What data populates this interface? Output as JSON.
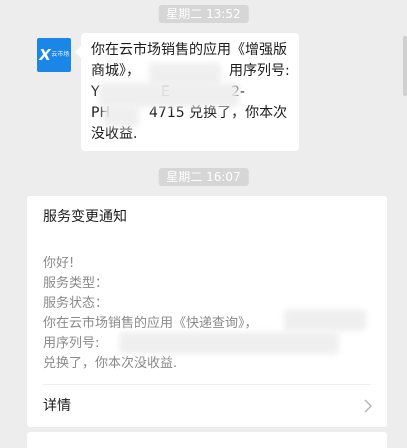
{
  "messages": [
    {
      "time": "星期二 13:52",
      "sender_avatar": {
        "icon": "cloud-market-logo",
        "mark": "X",
        "brand": "云市场"
      },
      "text_lines": [
        "你在云市场销售的应用《增强版",
        "商城》，",
        "用序列号:",
        "Y",
        "E",
        "2-",
        "PH",
        "4715 兑换了，你本次",
        "没收益."
      ]
    },
    {
      "time": "星期二 16:07",
      "card": {
        "title": "服务变更通知",
        "body_lines": [
          "你好!",
          "服务类型：",
          "服务状态：",
          "你在云市场销售的应用《快递查询》，",
          "用序列号:",
          "兑换了，你本次没收益."
        ],
        "details_label": "详情"
      }
    }
  ]
}
